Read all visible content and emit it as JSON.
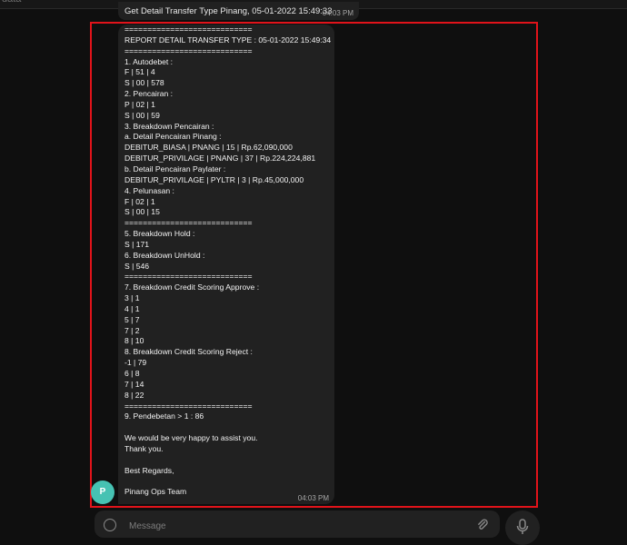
{
  "top_hint": "data",
  "previous_message": {
    "text": "Get Detail Transfer Type Pinang, 05-01-2022 15:49:33",
    "time": "04:03 PM"
  },
  "message": {
    "lines": [
      "============================",
      "REPORT DETAIL TRANSFER TYPE : 05-01-2022 15:49:34",
      "============================",
      "1. Autodebet :",
      "F | 51 | 4",
      "S | 00 | 578",
      "2. Pencairan :",
      "P | 02 | 1",
      "S | 00 | 59",
      "3. Breakdown Pencairan :",
      "a. Detail Pencairan Pinang  :",
      "DEBITUR_BIASA | PNANG | 15 | Rp.62,090,000",
      "DEBITUR_PRIVILAGE | PNANG | 37 | Rp.224,224,881",
      "b. Detail Pencairan Paylater :",
      "DEBITUR_PRIVILAGE | PYLTR | 3 | Rp.45,000,000",
      "4. Pelunasan :",
      "F | 02 | 1",
      "S | 00 | 15",
      "============================",
      "5. Breakdown Hold   :",
      "S | 171",
      "6. Breakdown UnHold   :",
      "S | 546",
      "============================",
      "7. Breakdown Credit Scoring Approve   :",
      "3 | 1",
      "4 | 1",
      "5 | 7",
      "7 | 2",
      "8 | 10",
      "8. Breakdown Credit Scoring Reject   :",
      "-1 | 79",
      "6 | 8",
      "7 | 14",
      "8 | 22",
      "============================",
      "9. Pendebetan > 1   : 86",
      "",
      "We would be very happy to assist you.",
      "Thank you.",
      "",
      "Best Regards,",
      "",
      "Pinang Ops Team"
    ],
    "time": "04:03 PM"
  },
  "sender": {
    "avatar_letter": "P",
    "avatar_color": "#46c2b3"
  },
  "composer": {
    "placeholder": "Message",
    "emoji_icon": "smile-icon",
    "attach_icon": "paperclip-icon",
    "mic_icon": "microphone-icon"
  },
  "colors": {
    "background": "#0f0f0f",
    "bubble": "#212121",
    "highlight": "#e1131a"
  }
}
